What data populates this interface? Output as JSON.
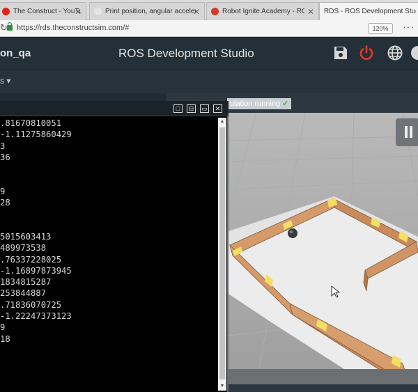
{
  "browser": {
    "tabs": [
      {
        "title": "The Construct - YouTube",
        "favicon_color": "#e62117",
        "close": "✕"
      },
      {
        "title": "Print position, angular acceleration",
        "favicon_color": "#e5e5e5",
        "close": "✕"
      },
      {
        "title": "Robot Ignite Academy - ROS",
        "favicon_color": "#d23a2c",
        "close": "✕"
      },
      {
        "title": "RDS - ROS Development Studio",
        "favicon_color": "#ffffff",
        "close": ""
      }
    ],
    "url": "https://rds.theconstructsim.com/#",
    "zoom": "120%",
    "menu": "···"
  },
  "header": {
    "user": "on_qa",
    "title": "ROS Development Studio",
    "icons": [
      "save-icon",
      "power-icon",
      "globe-icon",
      "user-icon"
    ],
    "power_color": "#e0362a"
  },
  "subbar": {
    "item": "s ▾"
  },
  "simulation": {
    "status": "ulation running",
    "check": "✓"
  },
  "terminal": {
    "buttons": [
      "□",
      "⊟",
      "▭",
      "✕"
    ],
    "lines": [
      ".81670810051",
      "-1.11275860429",
      "3",
      "36",
      "",
      "",
      "9",
      "28",
      "",
      "",
      "5015603413",
      "489973538",
      ".76337228025",
      "-1.16897873945",
      "1834815287",
      "253844887",
      ".71836070725",
      "-1.22247373123",
      "9",
      "18"
    ],
    "scroll_up": "▲",
    "scroll_down": "▼"
  }
}
